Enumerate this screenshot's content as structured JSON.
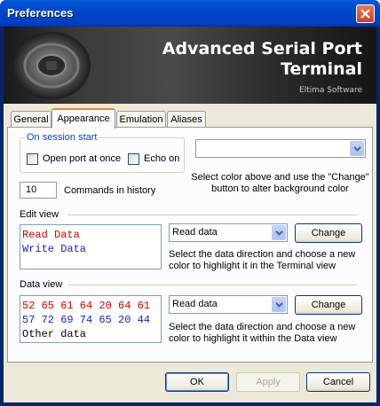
{
  "window": {
    "title": "Preferences"
  },
  "banner": {
    "title_line1": "Advanced Serial Port",
    "title_line2": "Terminal",
    "vendor": "Eltima Software"
  },
  "tabs": [
    {
      "label": "General",
      "active": false
    },
    {
      "label": "Appearance",
      "active": true
    },
    {
      "label": "Emulation",
      "active": false
    },
    {
      "label": "Aliases",
      "active": false
    }
  ],
  "session": {
    "group_label": "On session start",
    "open_port_label": "Open port at once",
    "open_port_checked": false,
    "echo_label": "Echo on",
    "echo_checked": false
  },
  "history": {
    "value": "10",
    "label": "Commands in history"
  },
  "background": {
    "color_value": "",
    "help": [
      "Select color above and use the \"Change\"",
      "button to alter background color"
    ]
  },
  "edit_view": {
    "title": "Edit view",
    "preview_lines": [
      {
        "text": "Read Data",
        "color": "#d40000"
      },
      {
        "text": "Write Data",
        "color": "#1a1ad4"
      }
    ],
    "direction_value": "Read data",
    "change_label": "Change",
    "help": [
      "Select the data direction and choose a new",
      "color to highlight it in the Terminal view"
    ]
  },
  "data_view": {
    "title": "Data view",
    "preview_lines": [
      {
        "text": "52 65 61 64 20 64 61",
        "color": "#d40000"
      },
      {
        "text": "57 72 69 74 65 20 44",
        "color": "#1a1ad4"
      },
      {
        "text": "Other data",
        "color": "#000000"
      }
    ],
    "direction_value": "Read data",
    "change_label": "Change",
    "help": [
      "Select the data direction and choose a new",
      "color to highlight it within the Data view"
    ]
  },
  "buttons": {
    "ok": "OK",
    "apply": "Apply",
    "cancel": "Cancel"
  },
  "colors": {
    "titlebar": "#0046c8",
    "dialog_bg": "#ece9d8",
    "tab_accent": "#e68b2c",
    "read": "#d40000",
    "write": "#1a1ad4"
  }
}
